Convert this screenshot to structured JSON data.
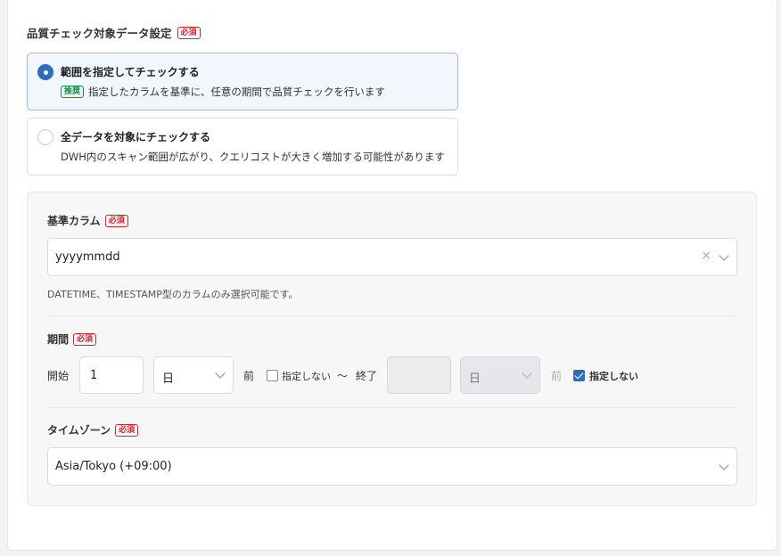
{
  "target": {
    "label": "品質チェック対象データ設定",
    "required_badge": "必須",
    "options": [
      {
        "title": "範囲を指定してチェックする",
        "badge": "推奨",
        "description": "指定したカラムを基準に、任意の期間で品質チェックを行います",
        "selected": true
      },
      {
        "title": "全データを対象にチェックする",
        "description": "DWH内のスキャン範囲が広がり、クエリコストが大きく増加する可能性があります",
        "selected": false
      }
    ]
  },
  "base_column": {
    "label": "基準カラム",
    "required_badge": "必須",
    "value": "yyyymmdd",
    "clear_icon": "×",
    "hint": "DATETIME、TIMESTAMP型のカラムのみ選択可能です。"
  },
  "period": {
    "label": "期間",
    "required_badge": "必須",
    "start_label": "開始",
    "start_value": "1",
    "start_unit": "日",
    "start_suffix": "前",
    "start_unspecified_label": "指定しない",
    "start_unspecified_checked": false,
    "tilde": "～",
    "end_label": "終了",
    "end_value": "",
    "end_unit": "日",
    "end_suffix": "前",
    "end_unspecified_label": "指定しない",
    "end_unspecified_checked": true
  },
  "timezone": {
    "label": "タイムゾーン",
    "required_badge": "必須",
    "value": "Asia/Tokyo (+09:00)"
  },
  "colors": {
    "accent": "#2f6dbb",
    "required": "#d1242f",
    "recommended": "#1a8a4a"
  }
}
